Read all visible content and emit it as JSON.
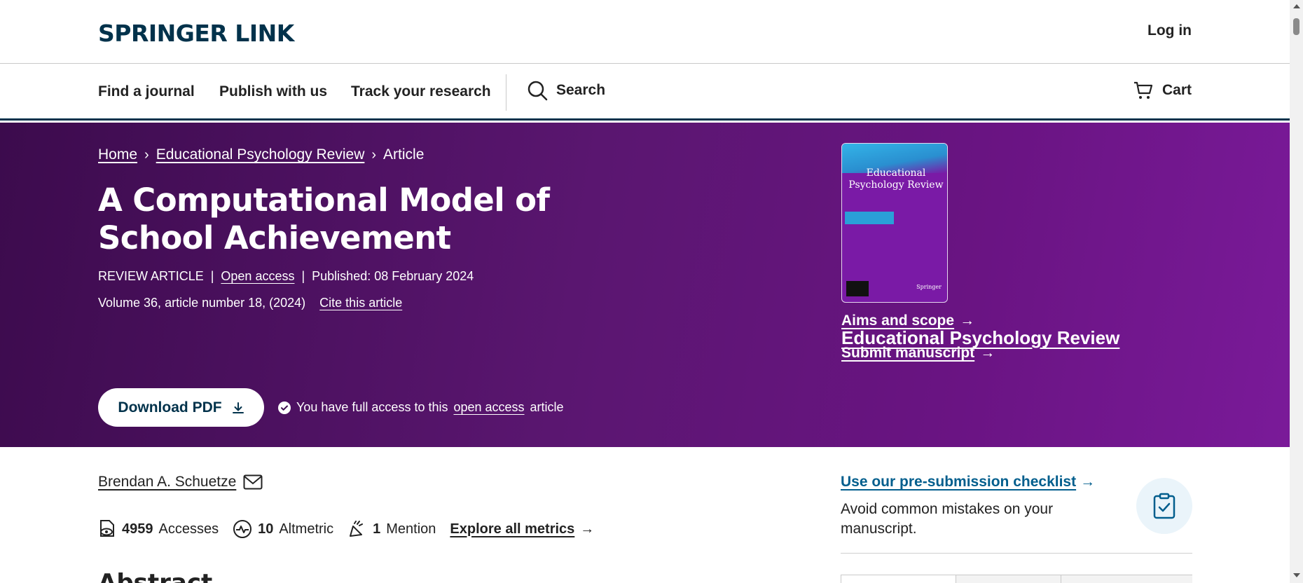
{
  "header": {
    "logo": "SPRINGER LINK",
    "login": "Log in"
  },
  "nav": {
    "items": [
      "Find a journal",
      "Publish with us",
      "Track your research"
    ],
    "search": "Search",
    "cart": "Cart"
  },
  "breadcrumb": [
    "Home",
    "Educational Psychology Review",
    "Article"
  ],
  "article": {
    "title": "A Computational Model of School Achievement",
    "type": "REVIEW ARTICLE",
    "open_access": "Open access",
    "published": "Published: 08 February 2024",
    "volume": "Volume 36, article number 18, (2024)",
    "cite": "Cite this article",
    "download": "Download PDF",
    "access_prefix": "You have full access to this",
    "access_link": "open access",
    "access_suffix": "article"
  },
  "journal": {
    "cover_title": "Educational Psychology Review",
    "cover_publisher": "Springer",
    "name": "Educational Psychology Review",
    "aims": "Aims and scope",
    "submit": "Submit manuscript"
  },
  "author": {
    "name": "Brendan A. Schuetze"
  },
  "metrics": {
    "accesses_count": "4959",
    "accesses_label": "Accesses",
    "altmetric_count": "10",
    "altmetric_label": "Altmetric",
    "mention_count": "1",
    "mention_label": "Mention",
    "explore": "Explore all metrics"
  },
  "sidebar": {
    "checklist_link": "Use our pre-submission checklist",
    "checklist_desc": "Avoid common mistakes on your manuscript."
  },
  "abstract_heading": "Abstract",
  "colors": {
    "brand_navy": "#01324b",
    "hero_purple": "#5a1670",
    "link_blue": "#025e8d"
  }
}
